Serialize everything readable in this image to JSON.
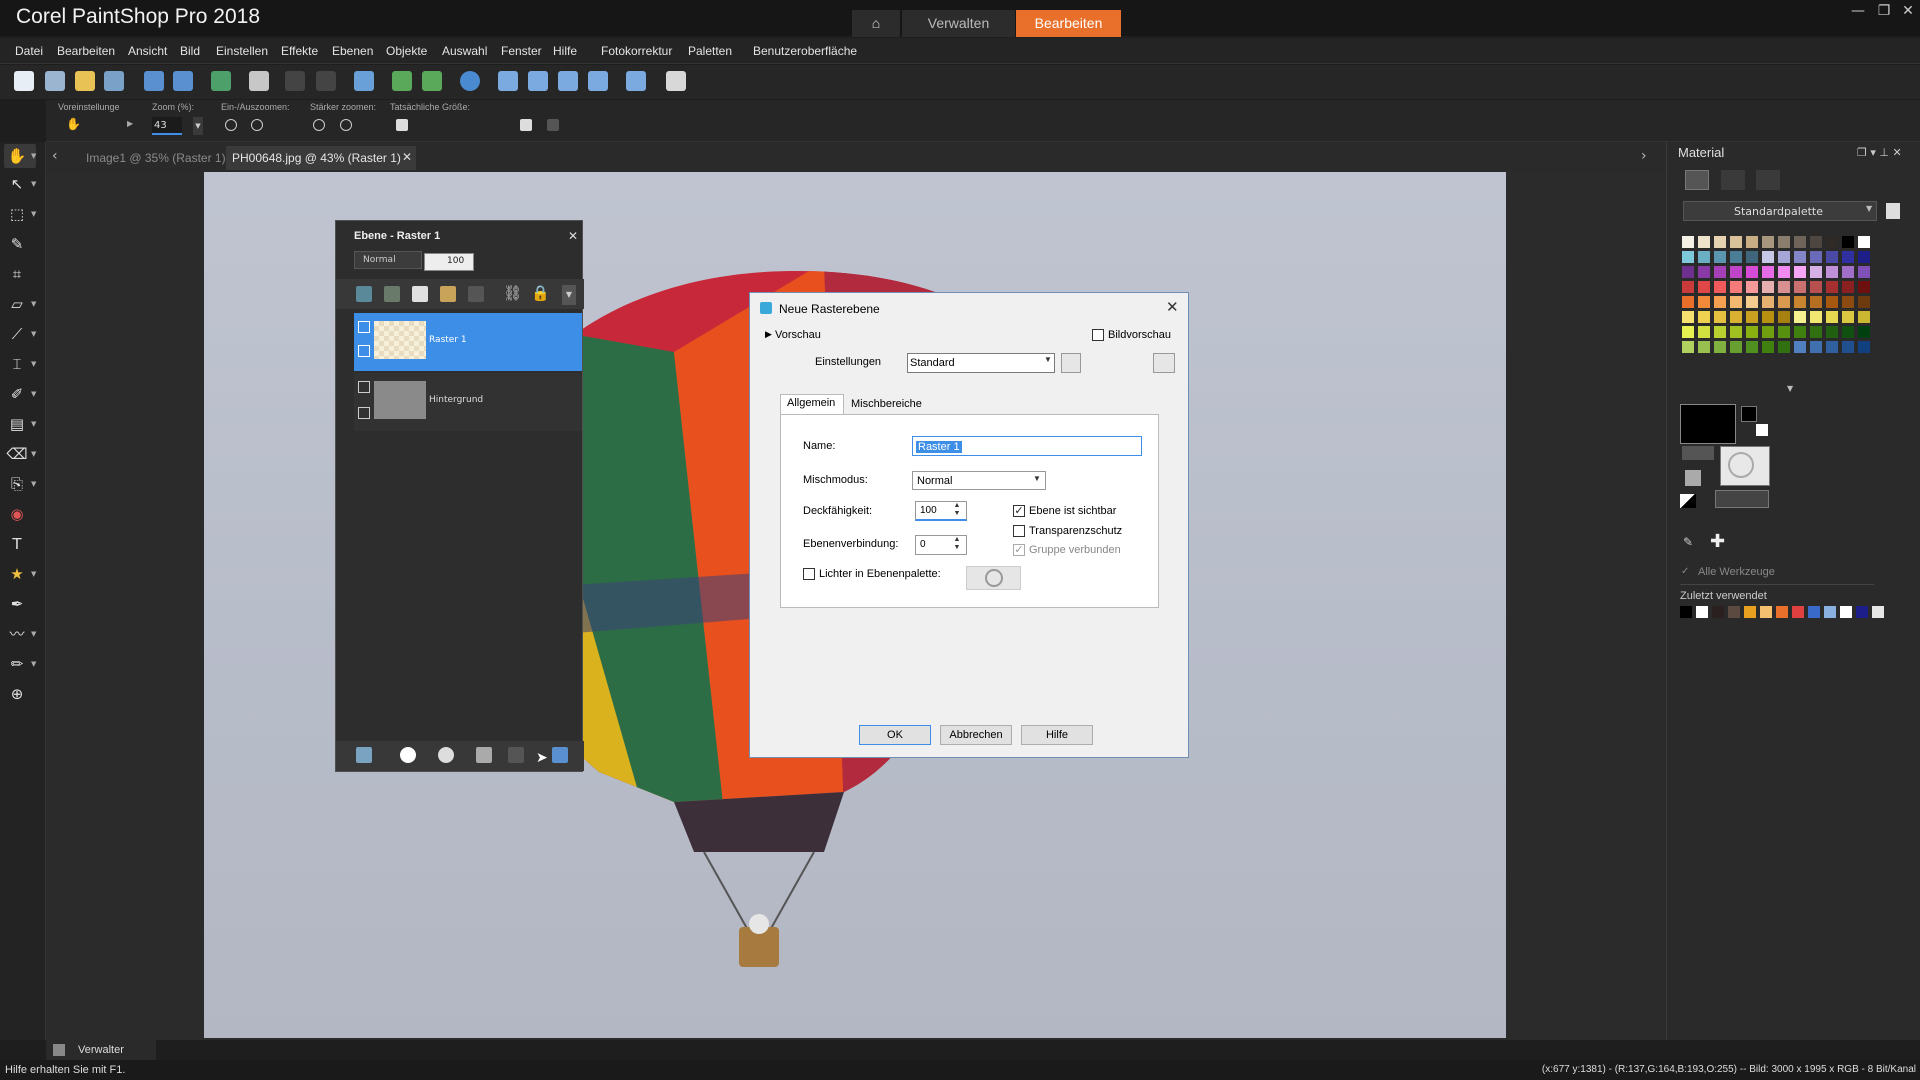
{
  "app": {
    "title": "Corel PaintShop Pro 2018"
  },
  "mode_tabs": {
    "manage": "Verwalten",
    "edit": "Bearbeiten"
  },
  "menu": [
    "Datei",
    "Bearbeiten",
    "Ansicht",
    "Bild",
    "Einstellen",
    "Effekte",
    "Ebenen",
    "Objekte",
    "Auswahl",
    "Fenster",
    "Hilfe",
    "Fotokorrektur",
    "Paletten",
    "Benutzeroberfläche"
  ],
  "options_bar": {
    "preset_label": "Voreinstellunge",
    "zoom_label": "Zoom (%):",
    "zoom_value": "43",
    "zoom_inout_label": "Ein-/Auszoomen:",
    "zoom_more_label": "Stärker zoomen:",
    "actual_size_label": "Tatsächliche Größe:"
  },
  "doc_tabs": [
    {
      "label": "Image1 @  35% (Raster 1)",
      "active": false
    },
    {
      "label": "PH00648.jpg @  43% (Raster 1)",
      "active": true
    }
  ],
  "layers_panel": {
    "title": "Ebene - Raster 1",
    "blend_mode": "Normal",
    "opacity": "100",
    "layers": [
      {
        "name": "Raster 1",
        "selected": true
      },
      {
        "name": "Hintergrund",
        "selected": false
      }
    ]
  },
  "dialog": {
    "title": "Neue Rasterebene",
    "preview_toggle": "Vorschau",
    "image_preview": "Bildvorschau",
    "settings_label": "Einstellungen",
    "settings_value": "Standard",
    "tabs": {
      "general": "Allgemein",
      "blend_ranges": "Mischbereiche"
    },
    "name_label": "Name:",
    "name_value": "Raster 1",
    "blend_label": "Mischmodus:",
    "blend_value": "Normal",
    "opacity_label": "Deckfähigkeit:",
    "opacity_value": "100",
    "link_label": "Ebenenverbindung:",
    "link_value": "0",
    "visible_label": "Ebene ist sichtbar",
    "visible_checked": true,
    "lock_transparency_label": "Transparenzschutz",
    "lock_transparency_checked": false,
    "group_linked_label": "Gruppe verbunden",
    "group_linked_checked": true,
    "highlight_label": "Lichter in Ebenenpalette:",
    "highlight_checked": false,
    "ok": "OK",
    "cancel": "Abbrechen",
    "help": "Hilfe"
  },
  "material": {
    "title": "Material",
    "palette_select": "Standardpalette",
    "all_tools": "Alle Werkzeuge",
    "recent_label": "Zuletzt verwendet"
  },
  "bottom": {
    "manager_tab": "Verwalter"
  },
  "status": {
    "left": "Hilfe erhalten Sie mit F1.",
    "right": "(x:677 y:1381) - (R:137,G:164,B:193,O:255) -- Bild:  3000 x 1995 x RGB - 8 Bit/Kanal"
  },
  "colors": {
    "accent": "#e8702a",
    "selection": "#3d8ee6"
  }
}
